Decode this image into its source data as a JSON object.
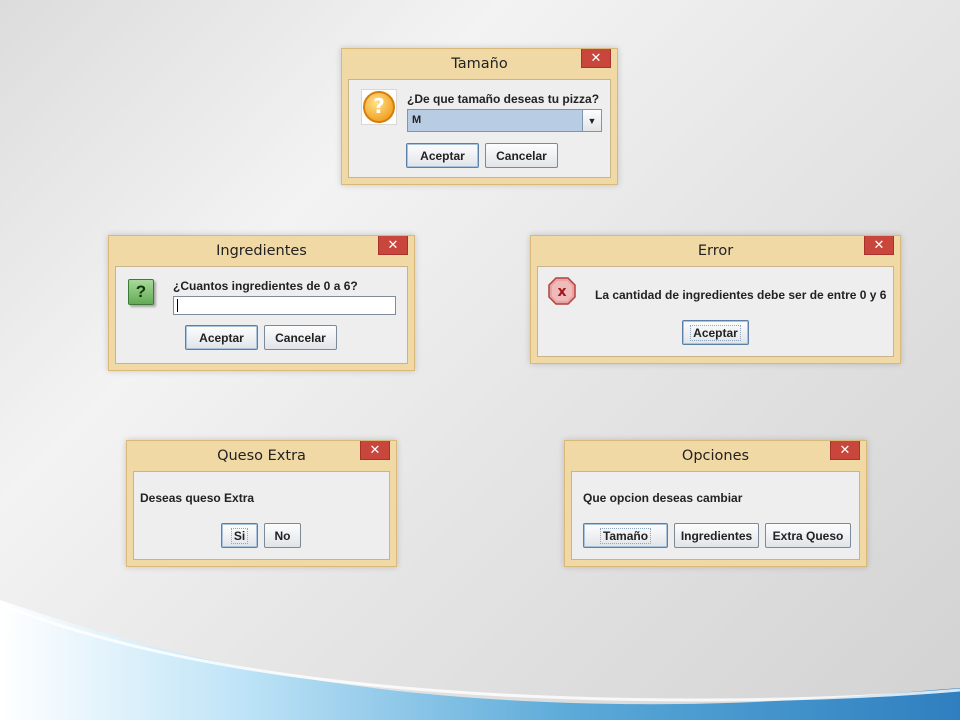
{
  "dialogs": {
    "tamano": {
      "title": "Tamaño",
      "close": "✕",
      "message": "¿De que tamaño deseas tu pizza?",
      "combo_value": "M",
      "buttons": {
        "accept": "Aceptar",
        "cancel": "Cancelar"
      },
      "icon": "question-orange-icon"
    },
    "ingredientes": {
      "title": "Ingredientes",
      "close": "✕",
      "message": "¿Cuantos ingredientes de 0 a 6?",
      "input_value": "",
      "buttons": {
        "accept": "Aceptar",
        "cancel": "Cancelar"
      },
      "icon": "question-green-icon"
    },
    "error": {
      "title": "Error",
      "close": "✕",
      "message": "La cantidad de ingredientes debe ser de entre 0 y 6",
      "buttons": {
        "accept": "Aceptar"
      },
      "icon": "error-icon"
    },
    "queso": {
      "title": "Queso Extra",
      "close": "✕",
      "message": "Deseas queso Extra",
      "buttons": {
        "yes": "Si",
        "no": "No"
      }
    },
    "opciones": {
      "title": "Opciones",
      "close": "✕",
      "message": "Que opcion deseas cambiar",
      "buttons": {
        "size": "Tamaño",
        "ingredients": "Ingredientes",
        "cheese": "Extra Queso"
      }
    }
  },
  "colors": {
    "dialog_frame": "#f0d9a5",
    "close_button": "#c9463d",
    "content_bg": "#eeeeee",
    "combo_selected": "#b8cde3"
  }
}
